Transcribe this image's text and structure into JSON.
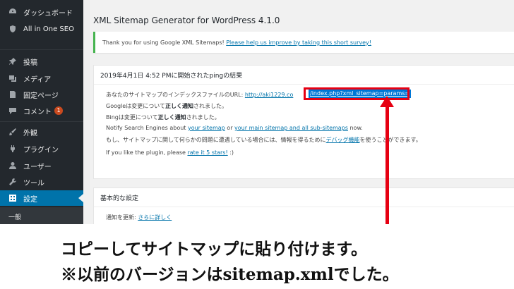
{
  "sidebar": {
    "items": [
      {
        "label": "ダッシュボード",
        "icon": "dashboard-icon"
      },
      {
        "label": "All in One SEO",
        "icon": "shield-icon"
      },
      {
        "label": "投稿",
        "icon": "pin-icon"
      },
      {
        "label": "メディア",
        "icon": "media-icon"
      },
      {
        "label": "固定ページ",
        "icon": "page-icon"
      },
      {
        "label": "コメント",
        "icon": "comment-icon",
        "badge": "1"
      },
      {
        "label": "外観",
        "icon": "brush-icon"
      },
      {
        "label": "プラグイン",
        "icon": "plugin-icon"
      },
      {
        "label": "ユーザー",
        "icon": "user-icon"
      },
      {
        "label": "ツール",
        "icon": "wrench-icon"
      },
      {
        "label": "設定",
        "icon": "settings-icon",
        "active": true
      }
    ],
    "submenu_label": "一般"
  },
  "main": {
    "title": "XML Sitemap Generator for WordPress 4.1.0",
    "notice": {
      "text": "Thank you for using Google XML Sitemaps! ",
      "link": "Please help us improve by taking this short survey!"
    },
    "ping_box": {
      "title": "2019年4月1日 4:52 PMに開始されたpingの結果",
      "line1_text": "あなたのサイトマップのインデックスファイルのURL: ",
      "line1_url": "http://aki1229.co",
      "line1_url_highlight": "/index.php?xml_sitemap=params=",
      "google_pre": "Googleは変更について",
      "google_bold": "正しく通知",
      "google_post": "されました。",
      "bing_pre": "Bingは変更について",
      "bing_bold": "正しく通知",
      "bing_post": "されました。",
      "notify_pre": "Notify Search Engines about ",
      "notify_link1": "your sitemap",
      "notify_mid": " or ",
      "notify_link2": "your main sitemap and all sub-sitemaps",
      "notify_post": " now.",
      "debug_pre": "もし、サイトマップに関して何らかの問題に遭遇している場合には、情報を得るために",
      "debug_link": "デバッグ機能",
      "debug_post": "を使うことができます。",
      "like_pre": "If you like the plugin, please ",
      "like_link": "rate it 5 stars!",
      "like_post": " :)"
    },
    "basic_box": {
      "title": "基本的な設定",
      "update_label": "通知を更新: ",
      "update_link": "さらに詳しく"
    }
  },
  "caption": {
    "line1": "コピーしてサイトマップに貼り付けます。",
    "line2": "※以前のバージョンはsitemap.xmlでした。"
  },
  "colors": {
    "sidebar_bg": "#23282d",
    "active": "#0073aa",
    "link": "#0073aa",
    "annotation_red": "#e60012",
    "notice_border": "#46b450"
  }
}
